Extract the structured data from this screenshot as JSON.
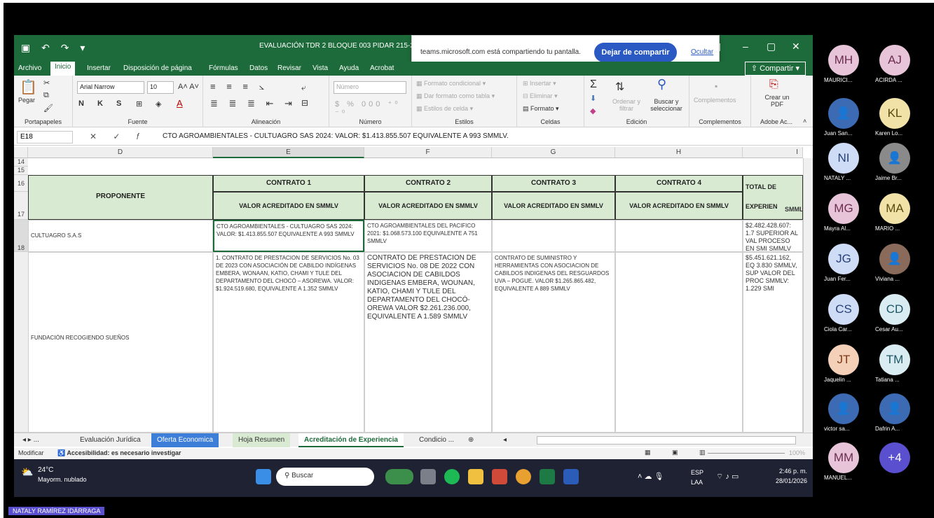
{
  "window": {
    "doc_title": "EVALUACIÓN TDR 2 BLOQUE 003 PIDAR 215-202",
    "share_message": "teams.microsoft.com está compartiendo tu pantalla.",
    "stop_share_label": "Dejar de compartir",
    "hide_label": "Ocultar",
    "share_button_label": "Compartir"
  },
  "menu": [
    "Archivo",
    "Inicio",
    "Insertar",
    "Disposición de página",
    "Fórmulas",
    "Datos",
    "Revisar",
    "Vista",
    "Ayuda",
    "Acrobat"
  ],
  "ribbon": {
    "paste": "Pegar",
    "clipboard_label": "Portapapeles",
    "font_name": "Arial Narrow",
    "font_size": "10",
    "font_label": "Fuente",
    "alignment_label": "Alineación",
    "number_format": "Número",
    "number_label": "Número",
    "cond_format": "Formato condicional",
    "table_format": "Dar formato como tabla",
    "cell_styles": "Estilos de celda",
    "styles_label": "Estilos",
    "insert": "Insertar",
    "delete": "Eliminar",
    "format": "Formato",
    "cells_label": "Celdas",
    "sort_filter": "Ordenar y filtrar",
    "find_select": "Buscar y seleccionar",
    "editing_label": "Edición",
    "addins": "Complementos",
    "addins_label": "Complementos",
    "create_pdf": "Crear un PDF",
    "adobe_label": "Adobe Ac..."
  },
  "formula_bar": {
    "cell_ref": "E18",
    "content": "CTO AGROAMBIENTALES - CULTUAGRO SAS 2024: VALOR: $1.413.855.507 EQUIVALENTE A 993 SMMLV."
  },
  "columns": [
    "D",
    "E",
    "F",
    "G",
    "H",
    "I"
  ],
  "rows": [
    "14",
    "15",
    "16",
    "17",
    "18",
    "19"
  ],
  "table": {
    "proponente_header": "PROPONENTE",
    "contracts": [
      "CONTRATO 1",
      "CONTRATO 2",
      "CONTRATO 3",
      "CONTRATO 4"
    ],
    "sub_header": "VALOR ACREDITADO EN SMMLV",
    "total_header": "TOTAL DE EXPERIEN",
    "total_sub": "SMML",
    "row1": {
      "name": "CULTUAGRO S.A.S",
      "c1": "CTO AGROAMBIENTALES - CULTUAGRO SAS 2024: VALOR: $1.413.855.507 EQUIVALENTE A 993 SMMLV",
      "c2": "CTO AGROAMBIENTALES DEL PACIFICO 2021: $1.068.573.100 EQUIVALENTE A 751 SMMLV",
      "c3": "",
      "c4": "",
      "total": "$2.482.428.607: 1.7 SUPERIOR AL VAL PROCESO EN SMI SMMLV"
    },
    "row2": {
      "name": "FUNDACIÓN RECOGIENDO SUEÑOS",
      "c1": "1. CONTRATO DE PRESTACION DE SERVICIOS No. 03 DE 2023 CON ASOCIACIÓN DE CABILDO INDÍGENAS EMBERA, WONAAN, KATIO, CHAMI Y TULE DEL DEPARTAMENTO DEL CHOCÓ – ASOREWA. VALOR: $1.924.519.680, EQUIVALENTE A 1.352 SMMLV",
      "c2": "CONTRATO DE PRESTACION DE SERVICIOS No. 08 DE 2022 CON ASOCIACION DE CABILDOS INDIGENAS EMBERA, WOUNAN, KATIO, CHAMI Y TULE DEL DEPARTAMENTO DEL CHOCÓ-OREWA VALOR $2.261.236.000, EQUIVALENTE A 1.589 SMMLV",
      "c3": "CONTRATO DE SUMINISTRO Y HERRAMIENTAS CON ASOCIACION DE CABILDOS INDIGENAS DEL RESGUARDOS UVA – POGUE. VALOR $1.265.865.482, EQUIVALENTE A 889 SMMLV",
      "c4": "",
      "total": "$5.451.621.162, EQ 3.830 SMMLV, SUP VALOR DEL PROC SMMLV: 1.229 SMI"
    }
  },
  "sheet_tabs": [
    "Evaluación Jurídica",
    "Oferta Economica",
    "Hoja Resumen",
    "Acreditación de Experiencia",
    "Condicio ..."
  ],
  "status": {
    "mode": "Modificar",
    "accessibility": "Accesibilidad: es necesario investigar",
    "zoom": "100%"
  },
  "taskbar": {
    "temp": "24°C",
    "weather": "Mayorm. nublado",
    "search": "Buscar",
    "lang": "ESP",
    "lang2": "LAA",
    "time": "2:46 p. m.",
    "date": "28/01/2026"
  },
  "presenter_name": "NATALY RAMÍREZ IDÁRRAGA",
  "participants": [
    {
      "initials": "MH",
      "name": "MAURICI...",
      "color": "#e8c4d8",
      "fg": "#6b2d4e"
    },
    {
      "initials": "AJ",
      "name": "ACIRDA ...",
      "color": "#e8c4d8",
      "fg": "#6b2d4e"
    },
    {
      "initials": "",
      "name": "Juan San...",
      "color": "#3d6bb3",
      "fg": "#ffffff"
    },
    {
      "initials": "KL",
      "name": "Karen Lo...",
      "color": "#f1e3a8",
      "fg": "#5a4a10"
    },
    {
      "initials": "NI",
      "name": "NATALY ...",
      "color": "#cfdcf5",
      "fg": "#243f7a"
    },
    {
      "initials": "",
      "name": "Jaime Br...",
      "color": "#8a8a8a",
      "fg": "#ffffff"
    },
    {
      "initials": "MG",
      "name": "Mayra Al...",
      "color": "#e8c4d8",
      "fg": "#6b2d4e"
    },
    {
      "initials": "MA",
      "name": "MARIO ...",
      "color": "#f1e3a8",
      "fg": "#5a4a10"
    },
    {
      "initials": "JG",
      "name": "Juan Fer...",
      "color": "#cfdcf5",
      "fg": "#243f7a"
    },
    {
      "initials": "",
      "name": "Viviana ...",
      "color": "#8a6a5a",
      "fg": "#ffffff"
    },
    {
      "initials": "CS",
      "name": "Ciola Car...",
      "color": "#cfdcf5",
      "fg": "#243f7a"
    },
    {
      "initials": "CD",
      "name": "Cesar Au...",
      "color": "#d8ecf2",
      "fg": "#1f5566"
    },
    {
      "initials": "JT",
      "name": "Jaquelin ...",
      "color": "#f4d0b8",
      "fg": "#7a3a12"
    },
    {
      "initials": "TM",
      "name": "Tatiana ...",
      "color": "#d8ecf2",
      "fg": "#1f5566"
    },
    {
      "initials": "",
      "name": "victor sa...",
      "color": "#3d6bb3",
      "fg": "#ffffff"
    },
    {
      "initials": "",
      "name": "Dafrin A...",
      "color": "#3d6bb3",
      "fg": "#ffffff"
    },
    {
      "initials": "MM",
      "name": "MANUEL...",
      "color": "#e8c4d8",
      "fg": "#6b2d4e"
    },
    {
      "initials": "+4",
      "name": "",
      "color": "#5a4fcf",
      "fg": "#ffffff"
    }
  ]
}
